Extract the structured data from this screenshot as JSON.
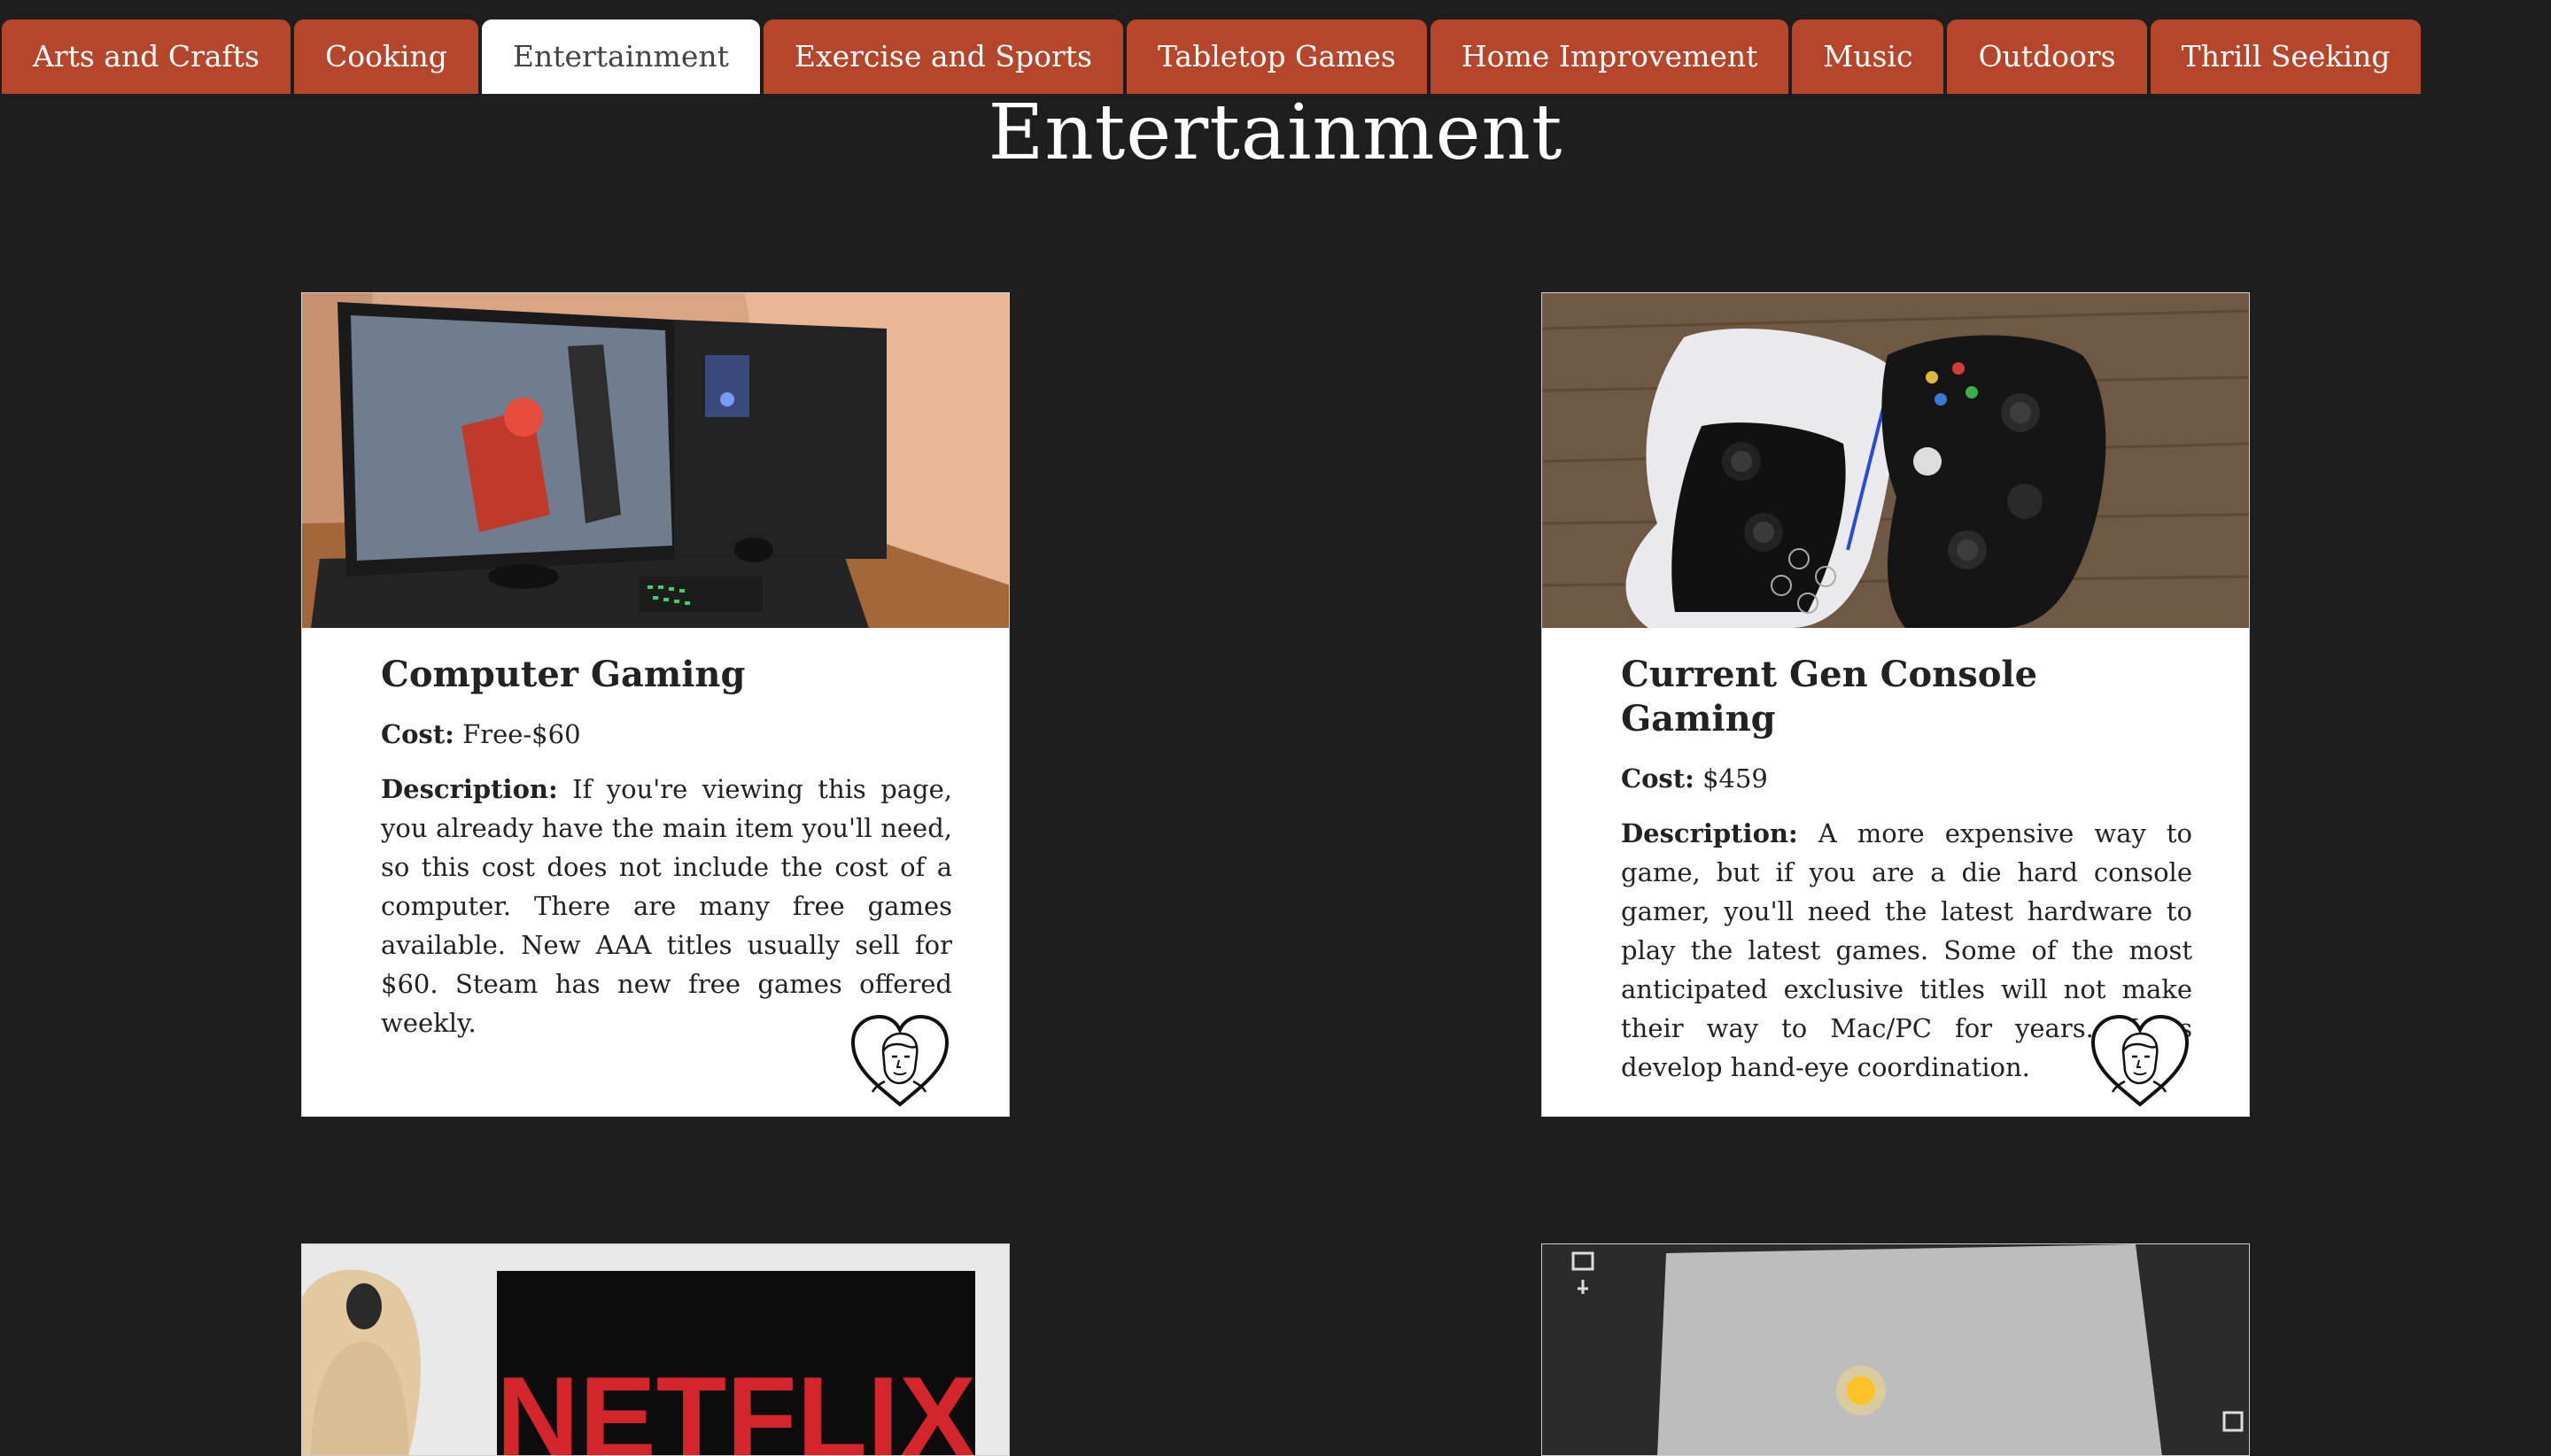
{
  "tabs": [
    {
      "label": "Arts and Crafts"
    },
    {
      "label": "Cooking"
    },
    {
      "label": "Entertainment",
      "active": true
    },
    {
      "label": "Exercise and Sports"
    },
    {
      "label": "Tabletop Games"
    },
    {
      "label": "Home Improvement"
    },
    {
      "label": "Music"
    },
    {
      "label": "Outdoors"
    },
    {
      "label": "Thrill Seeking"
    }
  ],
  "page_title": "Entertainment",
  "labels": {
    "cost": "Cost:",
    "description": "Description:"
  },
  "cards": [
    {
      "title": "Computer Gaming",
      "cost": "Free-$60",
      "description": "If you're viewing this page, you already have the main item you'll need, so this cost does not include the cost of a computer. There are many free games available. New AAA titles usually sell for $60. Steam has new free games offered weekly."
    },
    {
      "title": "Current Gen Console Gaming",
      "cost": "$459",
      "description": "A more expensive way to game, but if you are a die hard console gamer, you'll need the latest hardware to play the latest games. Some of the most anticipated exclusive titles will not make their way to Mac/PC for years. Helps develop hand-eye coordination."
    },
    {
      "photo_text": "NETFLIX"
    },
    {}
  ],
  "colors": {
    "background": "#1e1e1e",
    "tab": "#b5452b",
    "tab_active": "#ffffff",
    "card": "#ffffff",
    "netflix_red": "#d4252c"
  },
  "icons": {
    "favorite": "heart-face-icon"
  }
}
